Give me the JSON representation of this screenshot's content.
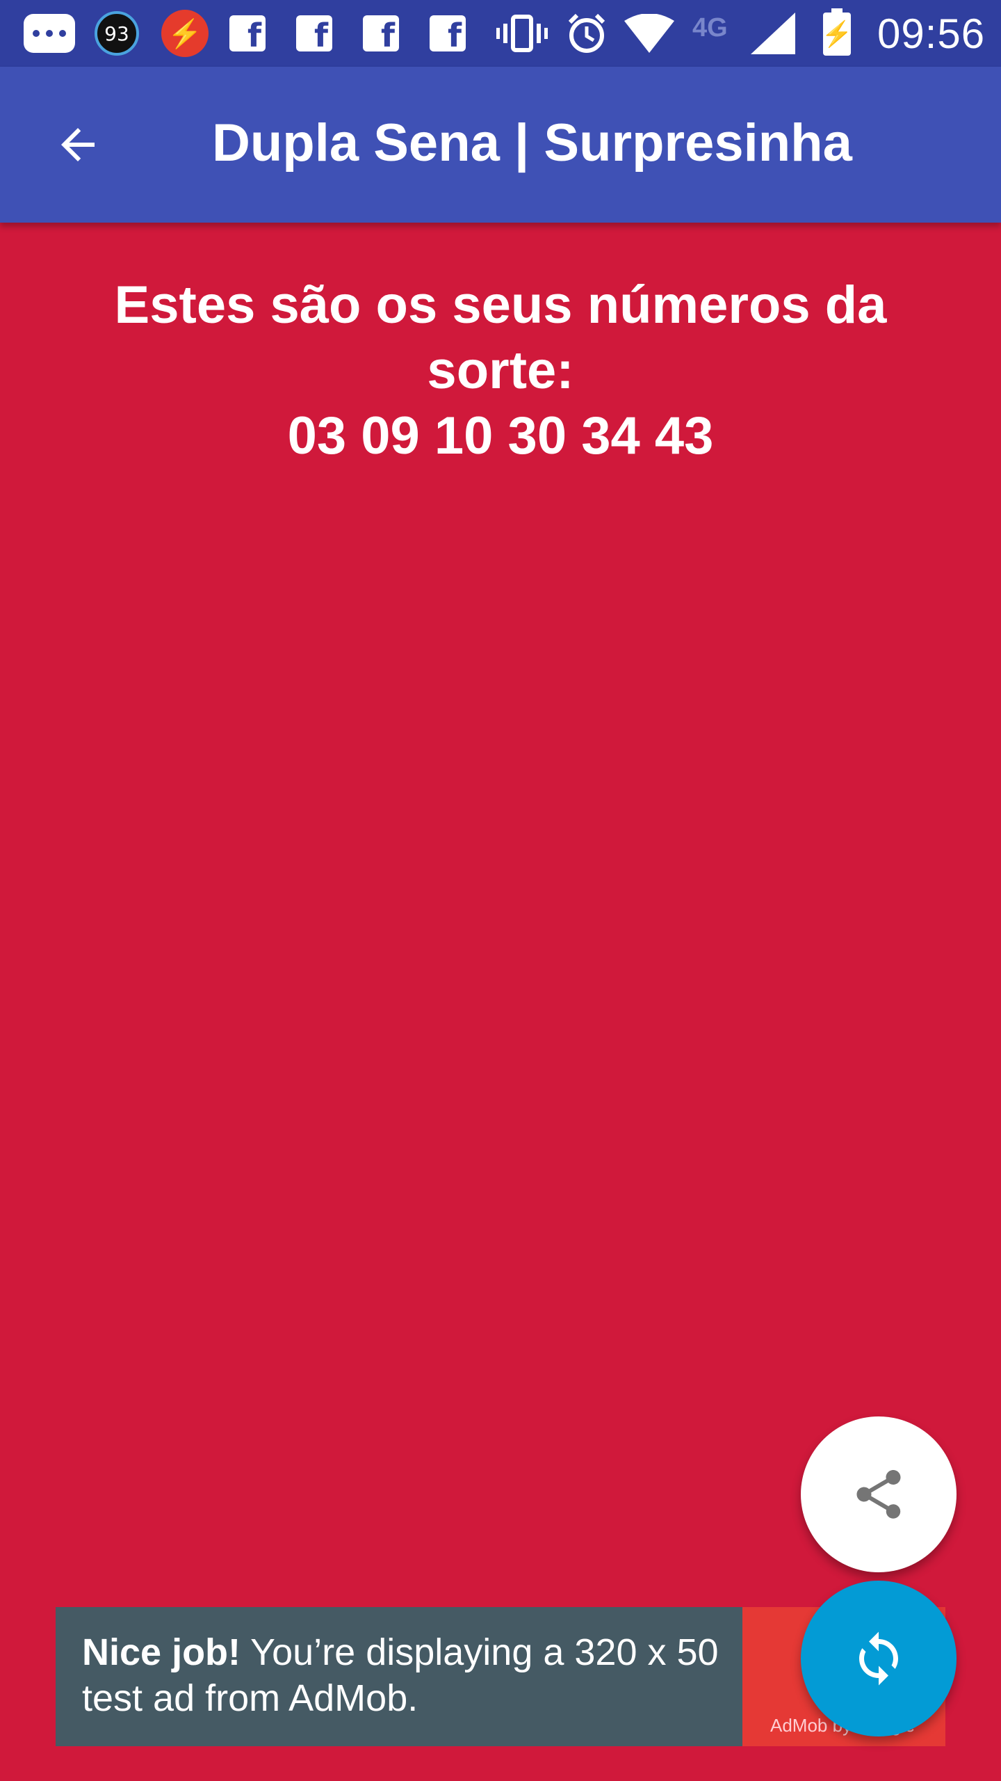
{
  "status_bar": {
    "badge_value": "93",
    "network_type": "4G",
    "time": "09:56",
    "icons": [
      "chat-icon",
      "battery-percent-badge-icon",
      "bolt-icon",
      "facebook-icon",
      "facebook-icon",
      "facebook-icon",
      "facebook-icon",
      "vibrate-icon",
      "alarm-icon",
      "wifi-icon",
      "cell-signal-icon",
      "battery-charging-icon"
    ]
  },
  "app_bar": {
    "title": "Dupla Sena | Surpresinha",
    "back_icon": "arrow-back-icon"
  },
  "main": {
    "message": "Estes são os seus números da sorte:",
    "numbers": "03 09 10 30 34 43"
  },
  "fabs": {
    "share_icon": "share-icon",
    "refresh_icon": "refresh-icon"
  },
  "ad": {
    "bold_text": "Nice job!",
    "text": " You’re displaying a 320 x 50 test ad from AdMob.",
    "brand": "AdMob by Google"
  },
  "colors": {
    "status_bar": "#303f9f",
    "app_bar": "#3f51b5",
    "background": "#d0193b",
    "fab_refresh": "#039bd5",
    "ad_background": "#455a64",
    "ad_accent": "#e53935"
  }
}
